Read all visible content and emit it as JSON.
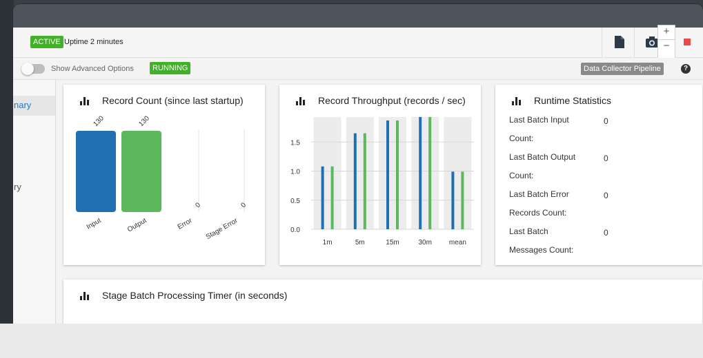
{
  "topbar": {
    "status_badge": "ACTIVE",
    "uptime": "Uptime 2 minutes",
    "zoom_in": "+",
    "zoom_out": "−"
  },
  "subbar": {
    "advanced_toggle_label": "Show Advanced Options",
    "running_badge": "RUNNING",
    "pipeline_badge": "Data Collector Pipeline",
    "help": "?"
  },
  "sidebar": {
    "items": [
      {
        "label": "nary",
        "active": true
      },
      {
        "label": "ry",
        "active": false
      }
    ]
  },
  "cards": {
    "record_count": {
      "title": "Record Count (since last startup)"
    },
    "throughput": {
      "title": "Record Throughput (records / sec)"
    },
    "runtime": {
      "title": "Runtime Statistics",
      "rows": [
        {
          "label_line1": "Last Batch Input",
          "label_line2": "Count:",
          "value": "0"
        },
        {
          "label_line1": "Last Batch Output",
          "label_line2": "Count:",
          "value": "0"
        },
        {
          "label_line1": "Last Batch Error",
          "label_line2": "Records Count:",
          "value": "0"
        },
        {
          "label_line1": "Last Batch",
          "label_line2": "Messages Count:",
          "value": "0"
        }
      ]
    },
    "stage_timer": {
      "title": "Stage Batch Processing Timer (in seconds)"
    }
  },
  "colors": {
    "blue": "#1f6fb2",
    "green": "#5cb85c",
    "active_green": "#43b02a",
    "stop_red": "#e94b4b"
  },
  "chart_data": [
    {
      "type": "bar",
      "categories": [
        "Input",
        "Output",
        "Error",
        "Stage Error"
      ],
      "values": [
        130,
        130,
        0,
        0
      ],
      "data_labels": [
        "130",
        "130",
        "0",
        "0"
      ],
      "colors": [
        "#1f6fb2",
        "#5cb85c",
        "#1f6fb2",
        "#5cb85c"
      ],
      "ylim": [
        0,
        130
      ]
    },
    {
      "type": "bar",
      "categories": [
        "1m",
        "5m",
        "15m",
        "30m",
        "mean"
      ],
      "series": [
        {
          "color": "#1f6fb2",
          "values": [
            1.08,
            1.65,
            1.87,
            1.93,
            0.99
          ]
        },
        {
          "color": "#5cb85c",
          "values": [
            1.08,
            1.65,
            1.87,
            1.93,
            0.99
          ]
        }
      ],
      "yticks": [
        "0.0",
        "0.5",
        "1.0",
        "1.5"
      ],
      "ylim": [
        0,
        1.95
      ],
      "grid": true
    }
  ]
}
